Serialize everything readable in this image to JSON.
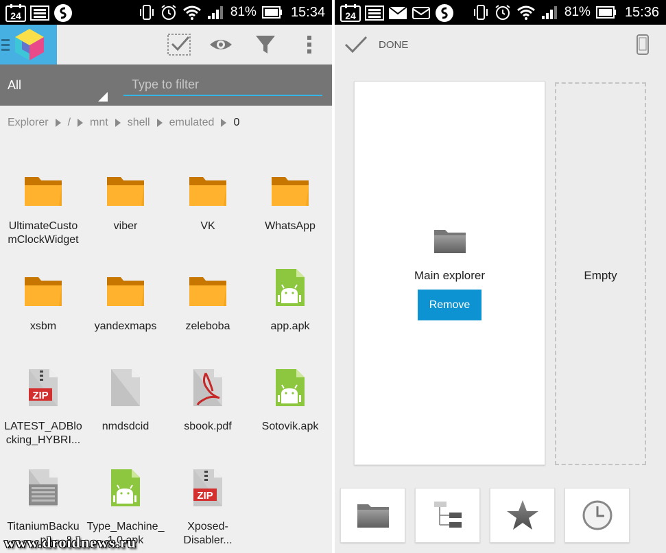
{
  "left": {
    "status": {
      "battery_pct": "81%",
      "time": "15:34",
      "calendar_day": "24"
    },
    "filter": {
      "selected": "All",
      "placeholder": "Type to filter"
    },
    "breadcrumb": [
      "Explorer",
      "/",
      "mnt",
      "shell",
      "emulated",
      "0"
    ],
    "files": [
      {
        "name": "UltimateCustomClockWidget",
        "display": "UltimateCusto\nmClockWidget",
        "icon": "folder-icon"
      },
      {
        "name": "viber",
        "display": "viber",
        "icon": "folder-icon"
      },
      {
        "name": "VK",
        "display": "VK",
        "icon": "folder-icon"
      },
      {
        "name": "WhatsApp",
        "display": "WhatsApp",
        "icon": "folder-icon"
      },
      {
        "name": "xsbm",
        "display": "xsbm",
        "icon": "folder-icon"
      },
      {
        "name": "yandexmaps",
        "display": "yandexmaps",
        "icon": "folder-icon"
      },
      {
        "name": "zeleboba",
        "display": "zeleboba",
        "icon": "folder-icon"
      },
      {
        "name": "app.apk",
        "display": "app.apk",
        "icon": "apk-icon"
      },
      {
        "name": "LATEST_ADBlocking_HYBRI...",
        "display": "LATEST_ADBlo\ncking_HYBRI...",
        "icon": "zip-icon"
      },
      {
        "name": "nmdsdcid",
        "display": "nmdsdcid",
        "icon": "file-icon"
      },
      {
        "name": "sbook.pdf",
        "display": "sbook.pdf",
        "icon": "pdf-icon"
      },
      {
        "name": "Sotovik.apk",
        "display": "Sotovik.apk",
        "icon": "apk-icon"
      },
      {
        "name": "TitaniumBackup",
        "display": "TitaniumBacku\np",
        "icon": "text-file-icon"
      },
      {
        "name": "Type_Machine_1.0.apk",
        "display": "Type_Machine_\n1.0.apk",
        "icon": "apk-icon"
      },
      {
        "name": "Xposed-Disabler",
        "display": "Xposed-\nDisabler...",
        "icon": "zip-icon"
      }
    ],
    "watermark": "www.droidnews.ru"
  },
  "right": {
    "status": {
      "battery_pct": "81%",
      "time": "15:36",
      "calendar_day": "24"
    },
    "toolbar": {
      "done_label": "DONE"
    },
    "main_card": {
      "label": "Main explorer",
      "remove_label": "Remove"
    },
    "empty_card": {
      "label": "Empty"
    }
  },
  "colors": {
    "accent": "#0d93d2",
    "folder": "#f5a623",
    "apk": "#8dc63f",
    "zip_red": "#d32f2f",
    "filter_bar": "#757575"
  }
}
